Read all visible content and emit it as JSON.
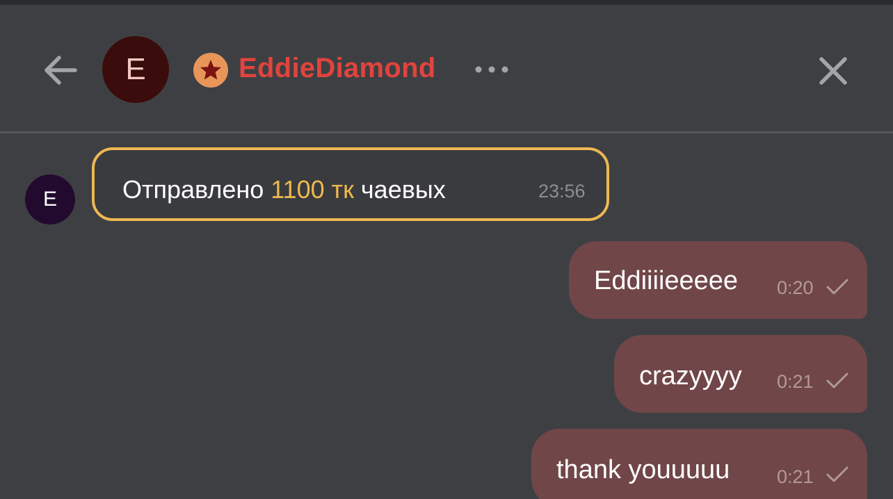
{
  "header": {
    "avatar_initial": "E",
    "username": "EddieDiamond",
    "badge_color": "#e8955a",
    "username_color": "#e0443d",
    "icons": {
      "back": "arrow-left-icon",
      "badge": "star-badge-icon",
      "more": "more-dots-icon",
      "close": "close-icon"
    }
  },
  "chat": {
    "sender_avatar_initial": "E",
    "tip": {
      "prefix": "Отправлено ",
      "amount": "1100 тк",
      "suffix": " чаевых",
      "time": "23:56",
      "accent_color": "#ecb852"
    },
    "messages": [
      {
        "text": "Eddiiiieeeee",
        "time": "0:20",
        "status": "sent-check-icon"
      },
      {
        "text": "crazyyyy",
        "time": "0:21",
        "status": "sent-check-icon"
      },
      {
        "text": "thank youuuuu",
        "time": "0:21",
        "status": "sent-check-icon"
      }
    ]
  }
}
